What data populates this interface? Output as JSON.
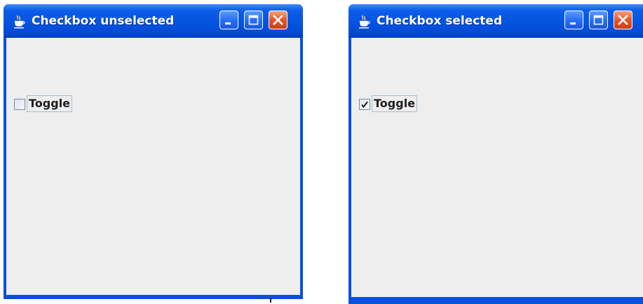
{
  "windows": [
    {
      "title": "Checkbox unselected",
      "checkbox": {
        "label": "Toggle",
        "checked": false
      }
    },
    {
      "title": "Checkbox selected",
      "checkbox": {
        "label": "Toggle",
        "checked": true
      }
    }
  ],
  "icons": {
    "app": "java-cup-icon",
    "minimize": "minimize-icon",
    "maximize": "maximize-icon",
    "close": "close-icon",
    "check": "check-mark-icon"
  },
  "colors": {
    "titlebar": "#0554e0",
    "client_background": "#eeeeee",
    "close_button": "#e2562a",
    "title_text": "#ffffff"
  }
}
